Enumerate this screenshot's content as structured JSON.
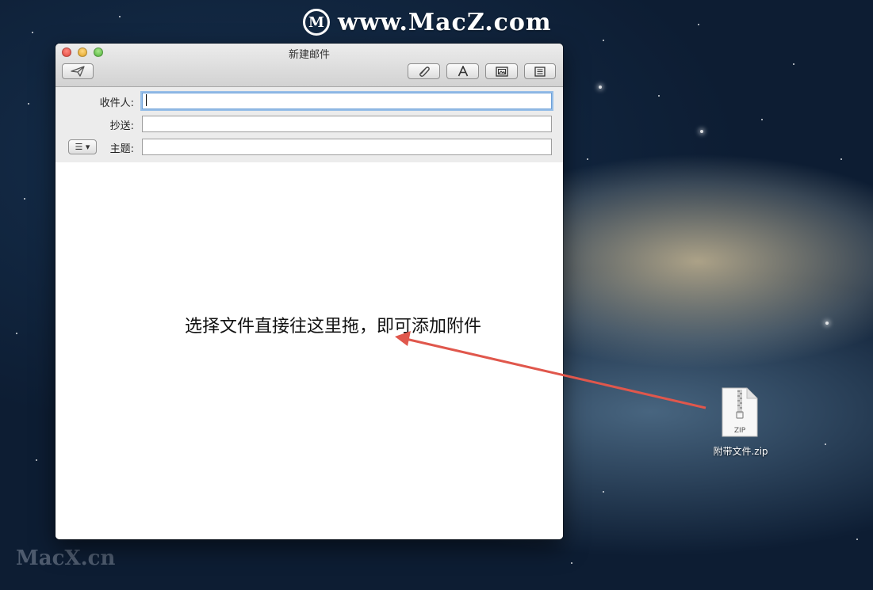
{
  "watermark": {
    "top_text": "www.MacZ.com",
    "logo_letter": "M",
    "bottom_text": "MacX.cn"
  },
  "window": {
    "title": "新建邮件",
    "toolbar": {
      "send_icon": "paper-plane-icon",
      "attach_icon": "paperclip-icon",
      "font_icon": "font-a-icon",
      "photo_icon": "photo-browser-icon",
      "template_icon": "stationery-icon"
    },
    "fields": {
      "to_label": "收件人:",
      "to_value": "",
      "cc_label": "抄送:",
      "cc_value": "",
      "subject_label": "主题:",
      "subject_value": "",
      "format_menu_icon": "list-format-icon",
      "format_menu_glyph": "☰ ▾"
    }
  },
  "annotation": {
    "text": "选择文件直接往这里拖，即可添加附件",
    "arrow_color": "#e0574c"
  },
  "desktop_file": {
    "name": "附带文件.zip",
    "icon": "zip-file-icon",
    "badge": "ZIP"
  }
}
